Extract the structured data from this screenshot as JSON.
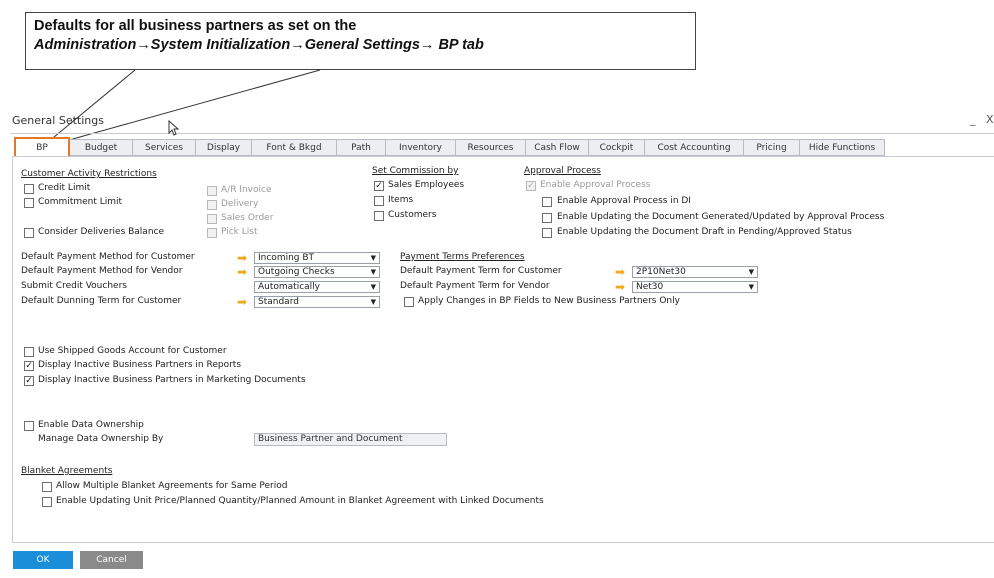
{
  "callout": {
    "line1": "Defaults for all business partners as set on the",
    "line2": "Administration→System Initialization→General Settings→ BP tab"
  },
  "window": {
    "title": "General Settings",
    "minimize": "_",
    "close": "X"
  },
  "tabs": [
    {
      "label": "BP",
      "active": true
    },
    {
      "label": "Budget"
    },
    {
      "label": "Services"
    },
    {
      "label": "Display"
    },
    {
      "label": "Font & Bkgd"
    },
    {
      "label": "Path"
    },
    {
      "label": "Inventory"
    },
    {
      "label": "Resources"
    },
    {
      "label": "Cash Flow"
    },
    {
      "label": "Cockpit"
    },
    {
      "label": "Cost Accounting"
    },
    {
      "label": "Pricing"
    },
    {
      "label": "Hide Functions"
    }
  ],
  "customer_activity": {
    "heading": "Customer Activity Restrictions",
    "credit_limit": {
      "label": "Credit Limit",
      "checked": false
    },
    "commitment_limit": {
      "label": "Commitment Limit",
      "checked": false
    },
    "consider_deliveries": {
      "label": "Consider Deliveries Balance",
      "checked": false
    },
    "ar_invoice": {
      "label": "A/R Invoice",
      "checked": false
    },
    "delivery": {
      "label": "Delivery",
      "checked": false
    },
    "sales_order": {
      "label": "Sales Order",
      "checked": false
    },
    "pick_list": {
      "label": "Pick List",
      "checked": false
    }
  },
  "commission": {
    "heading": "Set Commission by",
    "sales_employees": {
      "label": "Sales Employees",
      "checked": true
    },
    "items": {
      "label": "Items",
      "checked": false
    },
    "customers": {
      "label": "Customers",
      "checked": false
    }
  },
  "approval": {
    "heading": "Approval Process",
    "enable": {
      "label": "Enable Approval Process",
      "checked": true
    },
    "enable_di": {
      "label": "Enable Approval Process in DI",
      "checked": false
    },
    "enable_updating_generated": {
      "label": "Enable Updating the Document Generated/Updated by Approval Process",
      "checked": false
    },
    "enable_updating_draft": {
      "label": "Enable Updating the Document Draft in Pending/Approved Status",
      "checked": false
    }
  },
  "defaults": {
    "payment_method_customer": {
      "label": "Default Payment Method for Customer",
      "value": "Incoming BT"
    },
    "payment_method_vendor": {
      "label": "Default Payment Method for Vendor",
      "value": "Outgoing Checks"
    },
    "submit_credit_vouchers": {
      "label": "Submit Credit Vouchers",
      "value": "Automatically"
    },
    "dunning_term_customer": {
      "label": "Default Dunning Term for Customer",
      "value": "Standard"
    }
  },
  "payment_terms": {
    "heading": "Payment Terms Preferences",
    "customer": {
      "label": "Default Payment Term for Customer",
      "value": "2P10Net30"
    },
    "vendor": {
      "label": "Default Payment Term for Vendor",
      "value": "Net30"
    },
    "apply_changes": {
      "label": "Apply Changes in BP Fields to New Business Partners Only",
      "checked": false
    }
  },
  "options": {
    "shipped_goods": {
      "label": "Use Shipped Goods Account for Customer",
      "checked": false
    },
    "inactive_reports": {
      "label": "Display Inactive Business Partners in Reports",
      "checked": true
    },
    "inactive_marketing": {
      "label": "Display Inactive Business Partners in Marketing Documents",
      "checked": true
    }
  },
  "data_ownership": {
    "enable": {
      "label": "Enable Data Ownership",
      "checked": false
    },
    "manage_label": "Manage Data Ownership By",
    "manage_value": "Business Partner and Document"
  },
  "blanket": {
    "heading": "Blanket Agreements",
    "allow_multiple": {
      "label": "Allow Multiple Blanket Agreements for Same Period",
      "checked": false
    },
    "enable_updating": {
      "label": "Enable Updating Unit Price/Planned Quantity/Planned Amount in Blanket Agreement with Linked Documents",
      "checked": false
    }
  },
  "buttons": {
    "ok": "OK",
    "cancel": "Cancel"
  },
  "colors": {
    "accent": "#e07a2a",
    "ok_button": "#1a8ed8",
    "cancel_button": "#8a8a8a",
    "link_arrow": "#f0a81c"
  }
}
